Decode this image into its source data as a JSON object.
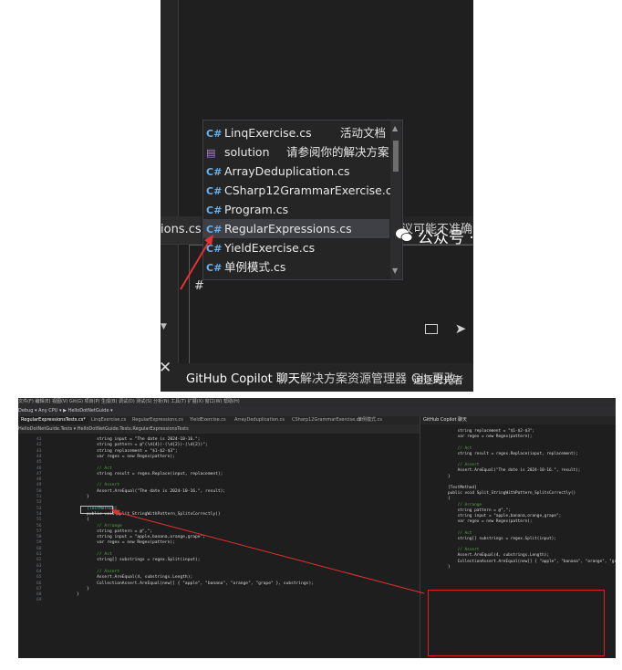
{
  "top": {
    "tab_left_label": "ions.cs",
    "hint_text": "议可能不准确",
    "chat_input_text": "#",
    "bottom_tabs": [
      "GitHub Copilot 聊天",
      "解决方案资源管理器",
      "Git 更改"
    ],
    "overlay_text": "追逐时光者",
    "paren_text": ")",
    "close_glyph": "✕",
    "autocomplete": [
      {
        "icon": "csharp-file-icon",
        "label": "LinqExercise.cs",
        "desc": "活动文档"
      },
      {
        "icon": "solution-icon",
        "label": "solution",
        "desc": "请参阅你的解决方案"
      },
      {
        "icon": "csharp-file-icon",
        "label": "ArrayDeduplication.cs",
        "desc": ""
      },
      {
        "icon": "csharp-file-icon",
        "label": "CSharp12GrammarExercise.cs",
        "desc": ""
      },
      {
        "icon": "csharp-file-icon",
        "label": "Program.cs",
        "desc": ""
      },
      {
        "icon": "csharp-file-icon",
        "label": "RegularExpressions.cs",
        "desc": "",
        "selected": true
      },
      {
        "icon": "csharp-file-icon",
        "label": "YieldExercise.cs",
        "desc": ""
      },
      {
        "icon": "csharp-file-icon",
        "label": "单例模式.cs",
        "desc": ""
      }
    ],
    "cs_glyph": "C#"
  },
  "bottom": {
    "menubar": "文件(F)  编辑(E)  视图(V)  Git(G)  项目(P)  生成(B)  调试(D)  测试(S)  分析(N)  工具(T)  扩展(X)  窗口(W)  帮助(H)",
    "toolbar": "Debug ▾   Any CPU ▾   ▶ HelloDotNetGuide ▾",
    "doc_tabs": [
      "RegularExpressionsTests.cs*",
      "LinqExercise.cs",
      "RegularExpressions.cs",
      "YieldExercise.cs",
      "ArrayDeduplication.cs",
      "CSharp12GrammarExercise.cs",
      "单例模式.cs"
    ],
    "navbar": "HelloDotNetGuide.Tests   ▾   HelloDotNetGuide.Tests.RegularExpressionsTests",
    "code_lines": [
      {
        "n": "41",
        "t": "        string input = \"The date is 2024-10-16.\";"
      },
      {
        "n": "42",
        "t": "        string pattern = @\"(\\d{4})-(\\d{2})-(\\d{2})\";"
      },
      {
        "n": "43",
        "t": "        string replacement = \"$1-$2-$3\";"
      },
      {
        "n": "44",
        "t": "        var regex = new Regex(pattern);"
      },
      {
        "n": "45",
        "t": ""
      },
      {
        "n": "46",
        "t": "        // Act"
      },
      {
        "n": "47",
        "t": "        string result = regex.Replace(input, replacement);"
      },
      {
        "n": "48",
        "t": ""
      },
      {
        "n": "49",
        "t": "        // Assert"
      },
      {
        "n": "50",
        "t": "        Assert.AreEqual(\"The date is 2024-10-16.\", result);"
      },
      {
        "n": "51",
        "t": "    }"
      },
      {
        "n": "52",
        "t": ""
      },
      {
        "n": "53",
        "t": "    [TestMethod]"
      },
      {
        "n": "54",
        "t": "    public void Split_StringWithPattern_SplitsCorrectly()"
      },
      {
        "n": "55",
        "t": "    {"
      },
      {
        "n": "56",
        "t": "        // Arrange"
      },
      {
        "n": "57",
        "t": "        string pattern = @\",\";"
      },
      {
        "n": "58",
        "t": "        string input = \"apple,banana,orange,grape\";"
      },
      {
        "n": "59",
        "t": "        var regex = new Regex(pattern);"
      },
      {
        "n": "60",
        "t": ""
      },
      {
        "n": "61",
        "t": "        // Act"
      },
      {
        "n": "62",
        "t": "        string[] substrings = regex.Split(input);"
      },
      {
        "n": "63",
        "t": ""
      },
      {
        "n": "64",
        "t": "        // Assert"
      },
      {
        "n": "65",
        "t": "        Assert.AreEqual(4, substrings.Length);"
      },
      {
        "n": "66",
        "t": "        CollectionAssert.AreEqual(new[] { \"apple\", \"banana\", \"orange\", \"grape\" }, substrings);"
      },
      {
        "n": "67",
        "t": "    }"
      },
      {
        "n": "68",
        "t": "}"
      },
      {
        "n": "69",
        "t": ""
      }
    ],
    "copilot_title": "GitHub Copilot 聊天",
    "copilot_code": [
      "    string replacement = \"$1-$2-$3\";",
      "    var regex = new Regex(pattern);",
      "",
      "    // Act",
      "    string result = regex.Replace(input, replacement);",
      "",
      "    // Assert",
      "    Assert.AreEqual(\"The date is 2024-10-16.\", result);",
      "}",
      "",
      "[TestMethod]",
      "public void Split_StringWithPattern_SplitsCorrectly()",
      "{",
      "    // Arrange",
      "    string pattern = @\",\";",
      "    string input = \"apple,banana,orange,grape\";",
      "    var regex = new Regex(pattern);",
      "",
      "    // Act",
      "    string[] substrings = regex.Split(input);",
      "",
      "    // Assert",
      "    Assert.AreEqual(4, substrings.Length);",
      "    CollectionAssert.AreEqual(new[] { \"apple\", \"banana\", \"orange\", \"grape\" }, substrings);",
      "}"
    ],
    "watermark": "公众号 · 追逐时光者"
  }
}
